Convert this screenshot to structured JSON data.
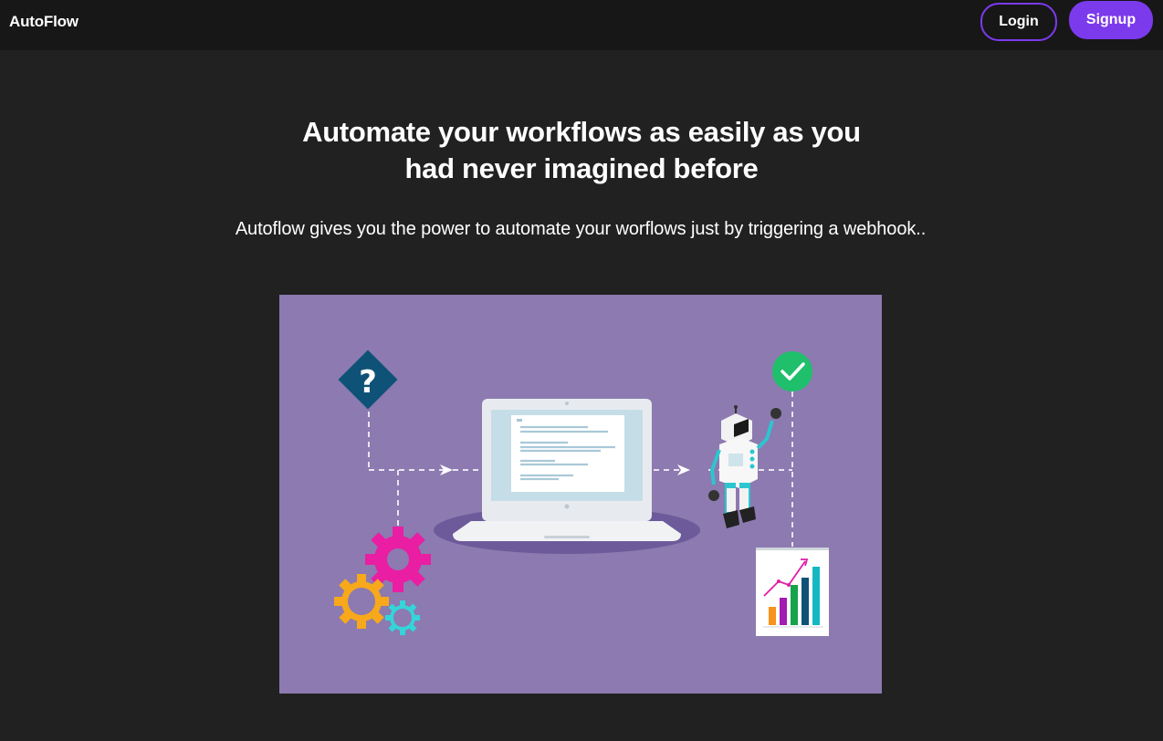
{
  "navbar": {
    "brand": "AutoFlow",
    "login_label": "Login",
    "signup_label": "Signup"
  },
  "hero": {
    "title_line1": "Automate your workflows as easily as you",
    "title_line2": "had never imagined before",
    "subtitle": "Autoflow gives you the power to automate your worflows just by triggering a webhook.."
  },
  "colors": {
    "background": "#212121",
    "navbar": "#171717",
    "accent": "#7c3aed",
    "illustration_bg": "#8c7ab0"
  }
}
